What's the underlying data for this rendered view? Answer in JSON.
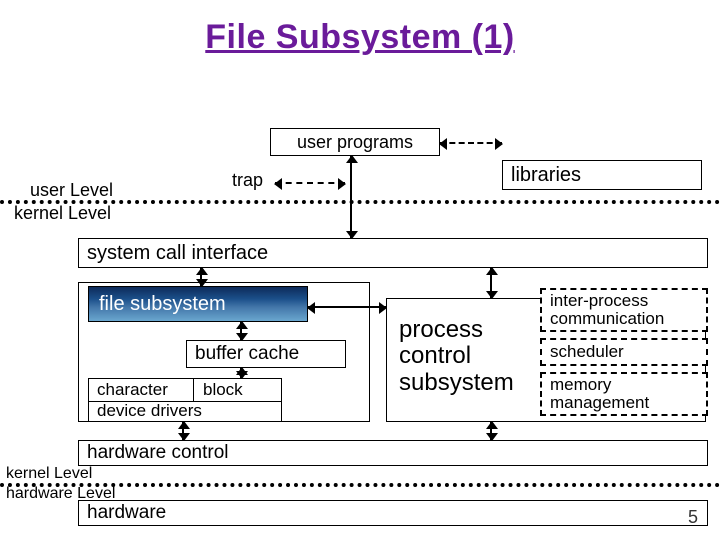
{
  "title": "File Subsystem (1)",
  "labels": {
    "user_programs": "user programs",
    "trap": "trap",
    "libraries": "libraries",
    "user_level": "user Level",
    "kernel_level_top": "kernel Level",
    "system_call_interface": "system call interface",
    "file_subsystem": "file subsystem",
    "buffer_cache": "buffer cache",
    "character": "character",
    "block": "block",
    "device_drivers": "device drivers",
    "process_control_subsystem": "process\ncontrol\nsubsystem",
    "ipc": "inter-process communication",
    "scheduler": "scheduler",
    "memory_management": "memory management",
    "hardware_control": "hardware control",
    "kernel_level_bottom": "kernel Level",
    "hardware_level": "hardware Level",
    "hardware": "hardware"
  },
  "page_number": "5"
}
